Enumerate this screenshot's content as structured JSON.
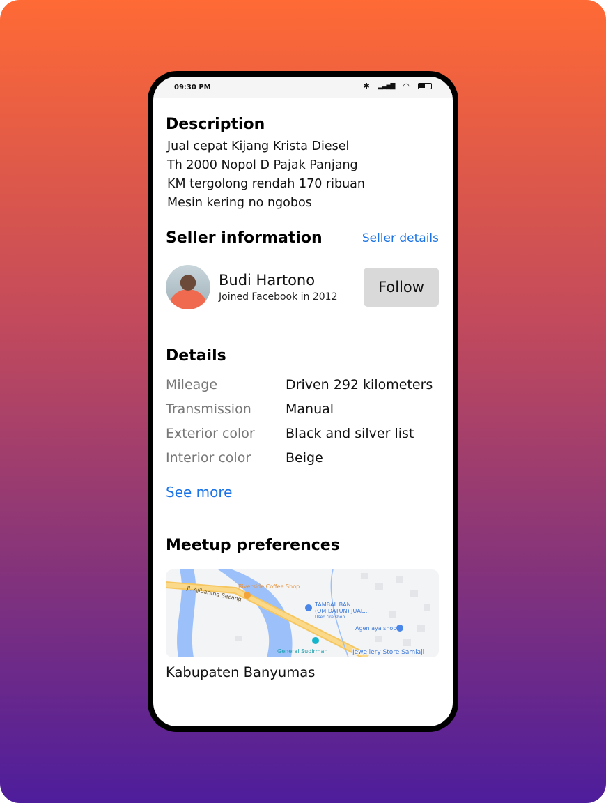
{
  "status_bar": {
    "time": "09:30 PM",
    "icons": [
      "bluetooth-icon",
      "signal-icon",
      "wifi-icon",
      "battery-icon"
    ],
    "battery_level": 0.45
  },
  "description": {
    "title": "Description",
    "lines": [
      "Jual cepat Kijang Krista Diesel",
      "Th 2000 Nopol D Pajak Panjang",
      "KM tergolong rendah 170 ribuan",
      "Mesin kering no ngobos"
    ]
  },
  "seller": {
    "title": "Seller information",
    "details_link": "Seller details",
    "name": "Budi Hartono",
    "joined": "Joined Facebook in 2012",
    "follow_label": "Follow"
  },
  "details": {
    "title": "Details",
    "rows": [
      {
        "label": "Mileage",
        "value": "Driven 292 kilometers"
      },
      {
        "label": "Transmission",
        "value": "Manual"
      },
      {
        "label": "Exterior color",
        "value": "Black and silver list"
      },
      {
        "label": "Interior color",
        "value": "Beige"
      }
    ],
    "see_more": "See more"
  },
  "meetup": {
    "title": "Meetup preferences",
    "map_labels": {
      "road": "Jl. Ajibarang Secang",
      "coffee": "Riverside Coffee Shop",
      "tire1": "TAMBAL BAN",
      "tire2": "(OM DATUN) JUAL...",
      "tire3": "Used tire shop",
      "agen": "Agen aya shop",
      "museum": "General Sudirman",
      "jewel": "Jewellery Store Samiaji"
    },
    "location": "Kabupaten Banyumas"
  },
  "colors": {
    "accent": "#1a73e8",
    "follow_bg": "#d9d9d9"
  }
}
